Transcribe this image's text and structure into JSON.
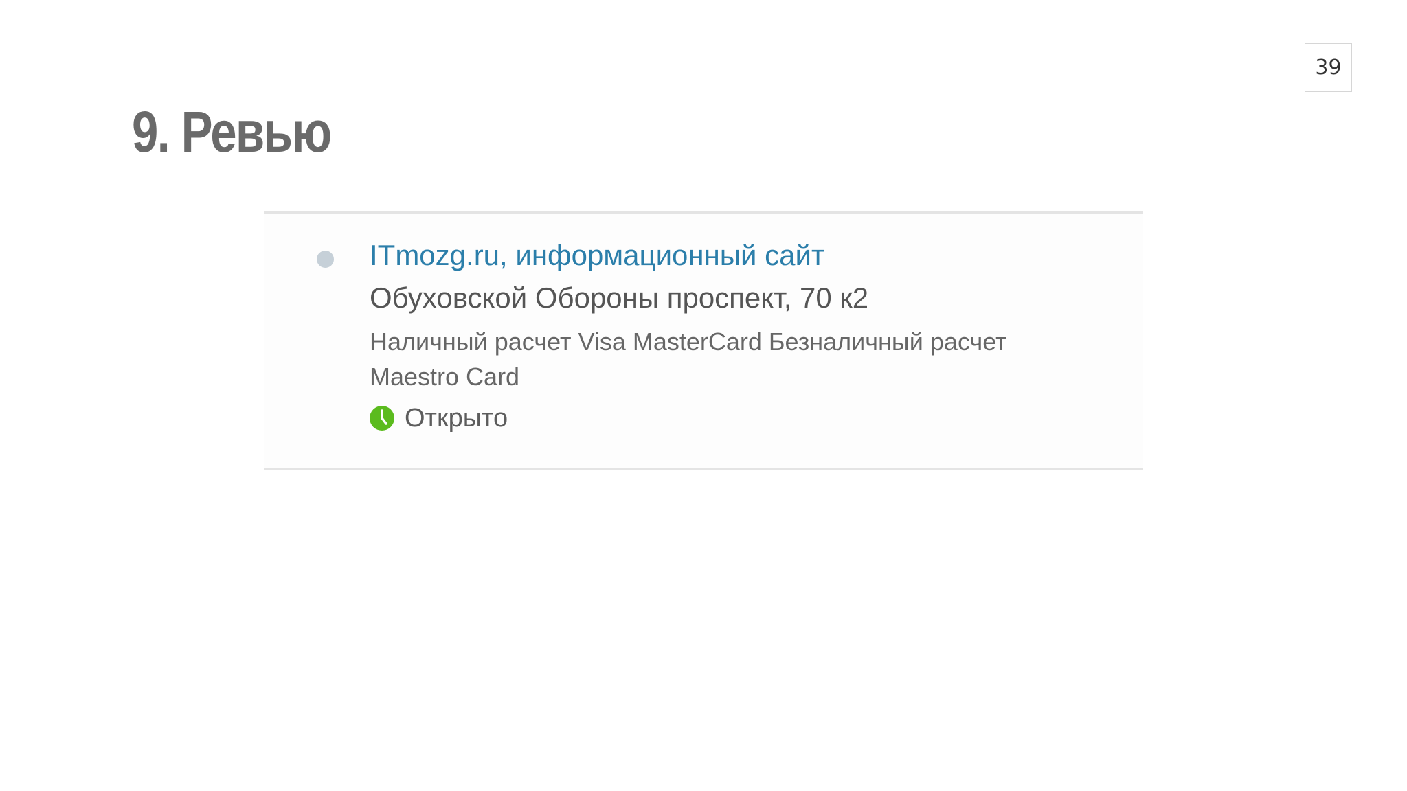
{
  "slide": {
    "page_number": "39",
    "title": "9. Ревью"
  },
  "listing": {
    "name": "ITmozg.ru, информационный сайт",
    "address": "Обуховской Обороны проспект, 70 к2",
    "payment_methods": "Наличный расчет Visa MasterCard Безналичный расчет Maestro Card",
    "status": "Открыто",
    "status_icon": "clock-icon",
    "colors": {
      "link": "#2b7eaa",
      "status_green": "#5bbb1e",
      "bullet": "#c6d0d8"
    }
  }
}
